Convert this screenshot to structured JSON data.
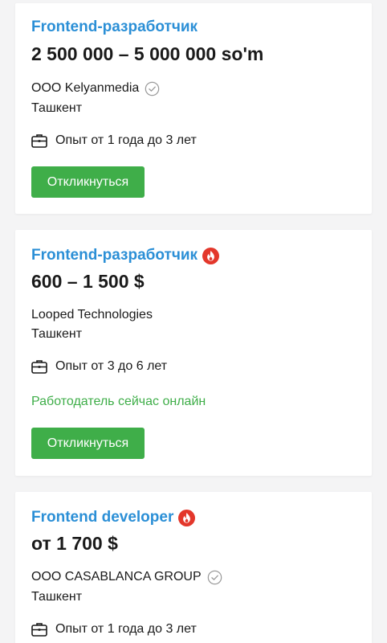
{
  "vacancies": [
    {
      "title": "Frontend-разработчик",
      "salary": "2 500 000 – 5 000 000 so'm",
      "company": "ООО Kelyanmedia",
      "company_verified": true,
      "city": "Ташкент",
      "experience": "Опыт от 1 года до 3 лет",
      "apply_label": "Откликнуться"
    },
    {
      "title": "Frontend-разработчик",
      "hot": true,
      "salary": "600 – 1 500 $",
      "company": "Looped Technologies",
      "city": "Ташкент",
      "experience": "Опыт от 3 до 6 лет",
      "employer_status": "Работодатель сейчас онлайн",
      "apply_label": "Откликнуться"
    },
    {
      "title": "Frontend developer",
      "hot": true,
      "salary": "от 1 700 $",
      "company": "ООО CASABLANCA GROUP",
      "company_verified": true,
      "city": "Ташкент",
      "experience": "Опыт от 1 года до 3 лет"
    }
  ],
  "colors": {
    "title": "#2b8fd6",
    "accent_green": "#3fae49",
    "hot_badge": "#e3372b",
    "background": "#f4f4f5",
    "card": "#ffffff"
  },
  "icons": {
    "hot": "flame-icon",
    "verified": "check-circle-icon",
    "experience": "briefcase-icon"
  }
}
